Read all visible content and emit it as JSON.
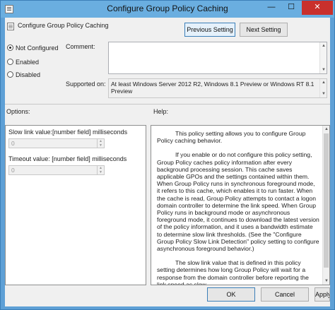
{
  "window": {
    "title": "Configure Group Policy Caching",
    "minimize_glyph": "—",
    "maximize_glyph": "☐",
    "close_glyph": "✕"
  },
  "header": {
    "title": "Configure Group Policy Caching",
    "previous_label": "Previous Setting",
    "next_label": "Next Setting"
  },
  "state": {
    "options": [
      "Not Configured",
      "Enabled",
      "Disabled"
    ],
    "selected": "Not Configured"
  },
  "comment": {
    "label": "Comment:",
    "value": ""
  },
  "supported": {
    "label": "Supported on:",
    "value": "At least Windows Server 2012 R2, Windows 8.1 Preview or Windows RT 8.1 Preview"
  },
  "options_panel": {
    "label": "Options:",
    "slow_link_label": "Slow link value:[number field] milliseconds",
    "slow_link_value": "0",
    "timeout_label": "Timeout value: [number field] milliseconds",
    "timeout_value": "0"
  },
  "help": {
    "label": "Help:",
    "paragraphs": [
      "This policy setting allows you to configure Group Policy caching behavior.",
      "If you enable or do not configure this policy setting, Group Policy caches policy information after every background processing session. This cache saves applicable GPOs and the settings contained within them. When Group Policy runs in synchronous foreground mode, it refers to this cache, which enables it to run faster. When the cache is read, Group Policy attempts to contact a logon domain controller to determine the link speed. When Group Policy runs in background mode or asynchronous foreground mode, it continues to download the latest version of the policy information, and it uses a bandwidth estimate to determine slow link thresholds. (See the \"Configure Group Policy Slow Link Detection\" policy setting to configure asynchronous foreground behavior.)",
      "The slow link value that is defined in this policy setting determines how long Group Policy will wait for a response from the domain controller before reporting the link speed as slow."
    ]
  },
  "footer": {
    "ok": "OK",
    "cancel": "Cancel",
    "apply": "Apply"
  }
}
